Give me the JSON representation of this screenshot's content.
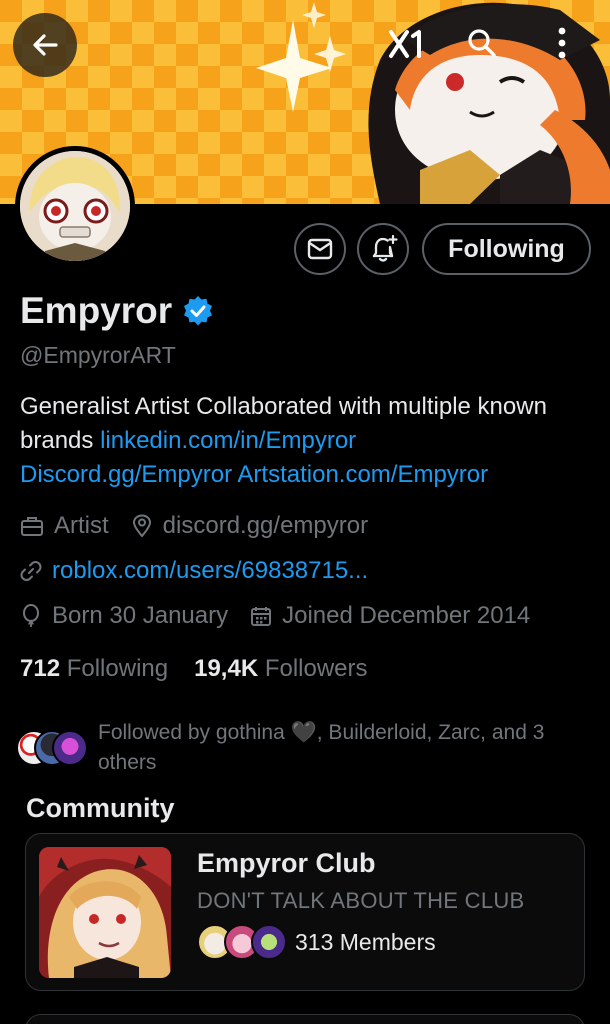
{
  "header": {
    "back_icon": "arrow-left-icon",
    "logo_text": "x1",
    "search_icon": "search-icon",
    "more_icon": "more-vertical-icon"
  },
  "profile": {
    "name": "Empyror",
    "verified_icon": "verified-badge-icon",
    "handle": "@EmpyrorART",
    "bio_text_1": "Generalist Artist Collaborated with multiple known brands ",
    "bio_link_1": "linkedin.com/in/Empyror",
    "bio_link_2": "Discord.gg/Empyror",
    "bio_link_3": "Artstation.com/Empyror",
    "profession": "Artist",
    "location": "discord.gg/empyror",
    "website": "roblox.com/users/69838715...",
    "birthday": "Born 30 January",
    "joined": "Joined December 2014"
  },
  "actions": {
    "message_icon": "envelope-icon",
    "notify_icon": "bell-plus-icon",
    "following_label": "Following"
  },
  "stats": {
    "following_count": "712",
    "following_label": "Following",
    "followers_count": "19,4K",
    "followers_label": "Followers"
  },
  "followed_by": {
    "text": "Followed by gothina 🖤, Builderloid, Zarc, and 3 others"
  },
  "community": {
    "section_title": "Community",
    "name": "Empyror Club",
    "description": "DON'T TALK ABOUT THE CLUB",
    "members": "313 Members"
  },
  "colors": {
    "background": "#000000",
    "text_primary": "#e7e9ea",
    "text_secondary": "#71767b",
    "link": "#1d9bf0",
    "verified": "#1d9bf0",
    "border": "#2f3336"
  }
}
